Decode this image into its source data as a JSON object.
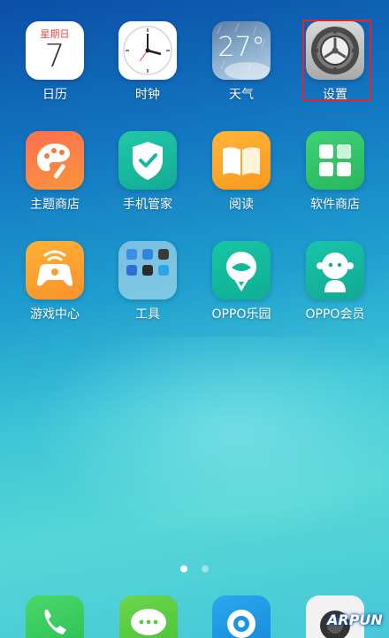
{
  "apps": [
    {
      "id": "calendar",
      "label": "日历",
      "weekday": "星期日",
      "day": "7"
    },
    {
      "id": "clock",
      "label": "时钟"
    },
    {
      "id": "weather",
      "label": "天气",
      "temp": "27°"
    },
    {
      "id": "settings",
      "label": "设置"
    },
    {
      "id": "theme-store",
      "label": "主题商店"
    },
    {
      "id": "phone-manager",
      "label": "手机管家"
    },
    {
      "id": "reader",
      "label": "阅读"
    },
    {
      "id": "app-store",
      "label": "软件商店"
    },
    {
      "id": "game-center",
      "label": "游戏中心"
    },
    {
      "id": "tools-folder",
      "label": "工具"
    },
    {
      "id": "oppo-paradise",
      "label": "OPPO乐园"
    },
    {
      "id": "oppo-member",
      "label": "OPPO会员"
    }
  ],
  "page_indicator": {
    "total": 2,
    "active": 1
  },
  "dock": [
    "phone-icon",
    "messages-icon",
    "browser-icon",
    "camera-icon"
  ],
  "watermark": "ARPUN",
  "colors": {
    "highlight": "#e0262b"
  }
}
